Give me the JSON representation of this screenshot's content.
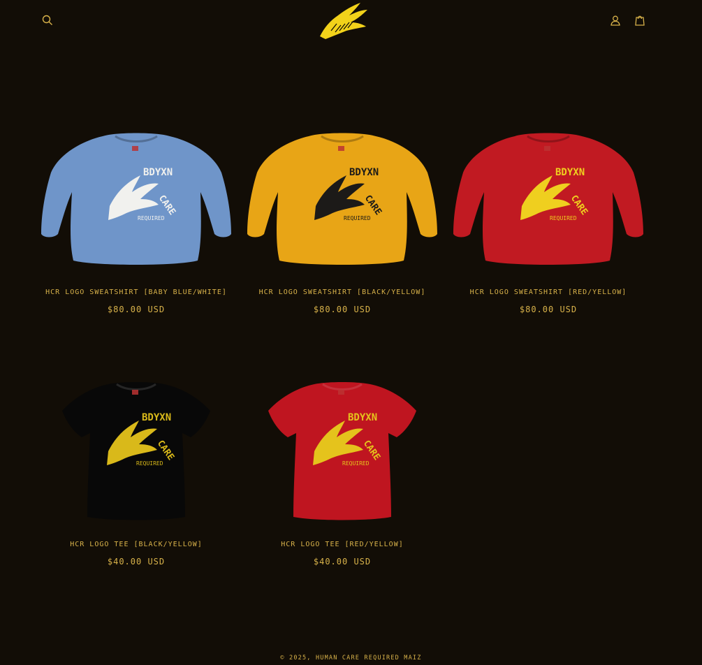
{
  "header": {
    "search_icon": "search-icon",
    "account_icon": "account-icon",
    "cart_icon": "cart-icon",
    "logo_icon": "corn-logo-icon"
  },
  "colors": {
    "background": "#120d06",
    "accent": "#d8b24a",
    "logo": "#f2d21a"
  },
  "products": [
    {
      "title": "HCR LOGO SWEATSHIRT [BABY BLUE/WHITE]",
      "price": "$80.00 USD",
      "garment": "sweatshirt",
      "body_color": "#6f95c9",
      "print_color": "#f1f1ee"
    },
    {
      "title": "HCR LOGO SWEATSHIRT [BLACK/YELLOW]",
      "price": "$80.00 USD",
      "garment": "sweatshirt",
      "body_color": "#e8a516",
      "print_color": "#1c1a18"
    },
    {
      "title": "HCR LOGO SWEATSHIRT [RED/YELLOW]",
      "price": "$80.00 USD",
      "garment": "sweatshirt",
      "body_color": "#c11a22",
      "print_color": "#efcf1f"
    },
    {
      "title": "HCR LOGO TEE [BLACK/YELLOW]",
      "price": "$40.00 USD",
      "garment": "tee",
      "body_color": "#080808",
      "print_color": "#d9b91a"
    },
    {
      "title": "HCR LOGO TEE [RED/YELLOW]",
      "price": "$40.00 USD",
      "garment": "tee",
      "body_color": "#bf1520",
      "print_color": "#e5c31c"
    }
  ],
  "footer": {
    "copyright": "© 2025, HUMAN CARE REQUIRED MAIZ"
  }
}
